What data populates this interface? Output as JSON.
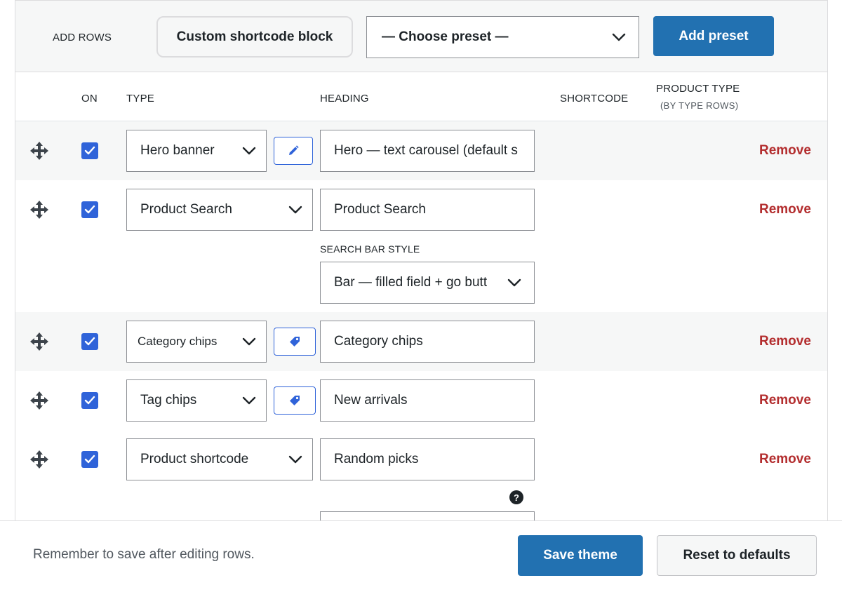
{
  "toolbar": {
    "label": "ADD ROWS",
    "custom_block_label": "Custom shortcode block",
    "preset_select_value": "— Choose preset —",
    "add_preset_label": "Add preset"
  },
  "columns": {
    "on": "ON",
    "type": "TYPE",
    "heading": "HEADING",
    "shortcode": "SHORTCODE",
    "product_type": "PRODUCT TYPE",
    "product_type_sub": "(BY TYPE ROWS)"
  },
  "rows": [
    {
      "type": "Hero banner",
      "heading": "Hero — text carousel (default s",
      "action_icon": "pencil-icon",
      "remove": "Remove"
    },
    {
      "type": "Product Search",
      "heading": "Product Search",
      "sub_label": "SEARCH BAR STYLE",
      "sub_select": "Bar — filled field + go butt",
      "remove": "Remove"
    },
    {
      "type": "Category chips",
      "heading": "Category chips",
      "action_icon": "tag-icon",
      "remove": "Remove"
    },
    {
      "type": "Tag chips",
      "heading": "New arrivals",
      "action_icon": "tag-icon",
      "remove": "Remove"
    },
    {
      "type": "Product shortcode",
      "heading": "Random picks",
      "help_icon": "question-icon",
      "help_glyph": "?",
      "remove": "Remove"
    }
  ],
  "footer": {
    "note": "Remember to save after editing rows.",
    "save_label": "Save theme",
    "reset_label": "Reset to defaults"
  },
  "colors": {
    "primary": "#2271b1",
    "checkbox": "#2f63d9",
    "danger": "#b32d2e",
    "row_alt": "#f6f7f7"
  }
}
